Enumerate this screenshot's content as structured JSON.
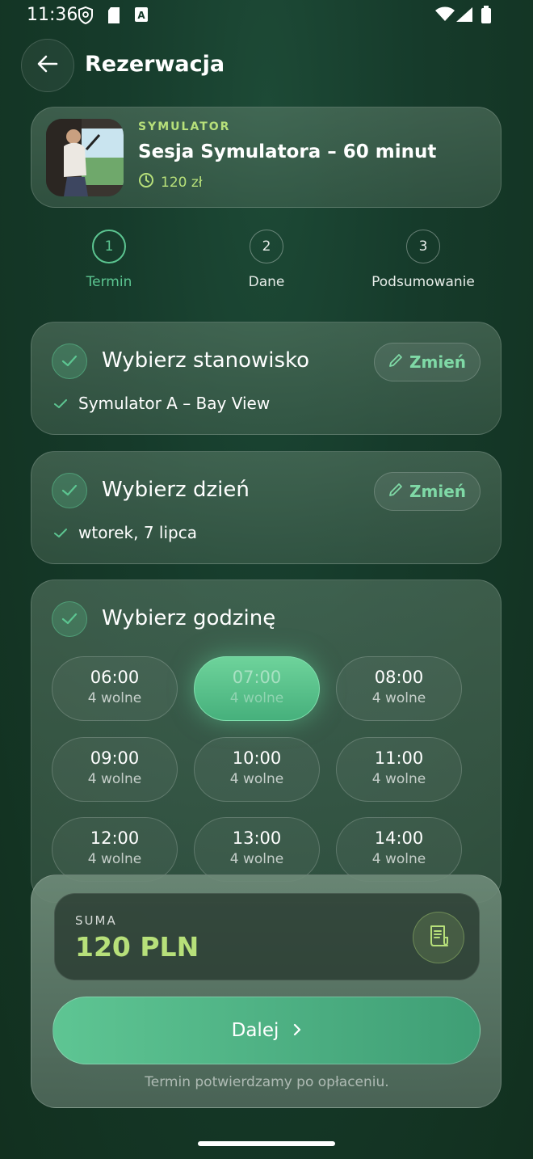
{
  "status_bar": {
    "time": "11:36"
  },
  "header": {
    "title": "Rezerwacja"
  },
  "product": {
    "category": "SYMULATOR",
    "name": "Sesja Symulatora – 60 minut",
    "price": "120 zł"
  },
  "steps": [
    {
      "number": "1",
      "label": "Termin",
      "active": true
    },
    {
      "number": "2",
      "label": "Dane",
      "active": false
    },
    {
      "number": "3",
      "label": "Podsumowanie",
      "active": false
    }
  ],
  "sections": {
    "station": {
      "title": "Wybierz stanowisko",
      "value": "Symulator A – Bay View",
      "change_label": "Zmień"
    },
    "day": {
      "title": "Wybierz dzień",
      "value": "wtorek, 7 lipca",
      "change_label": "Zmień"
    },
    "hour": {
      "title": "Wybierz godzinę"
    }
  },
  "time_slots": [
    {
      "time": "06:00",
      "availability": "4 wolne",
      "selected": false
    },
    {
      "time": "07:00",
      "availability": "4 wolne",
      "selected": true
    },
    {
      "time": "08:00",
      "availability": "4 wolne",
      "selected": false
    },
    {
      "time": "09:00",
      "availability": "4 wolne",
      "selected": false
    },
    {
      "time": "10:00",
      "availability": "4 wolne",
      "selected": false
    },
    {
      "time": "11:00",
      "availability": "4 wolne",
      "selected": false
    },
    {
      "time": "12:00",
      "availability": "4 wolne",
      "selected": false
    },
    {
      "time": "13:00",
      "availability": "4 wolne",
      "selected": false
    },
    {
      "time": "14:00",
      "availability": "4 wolne",
      "selected": false
    }
  ],
  "summary": {
    "label": "SUMA",
    "total": "120 PLN",
    "next_label": "Dalej",
    "note": "Termin potwierdzamy po opłaceniu."
  },
  "colors": {
    "accent": "#5cc591",
    "price": "#b7e07a"
  }
}
